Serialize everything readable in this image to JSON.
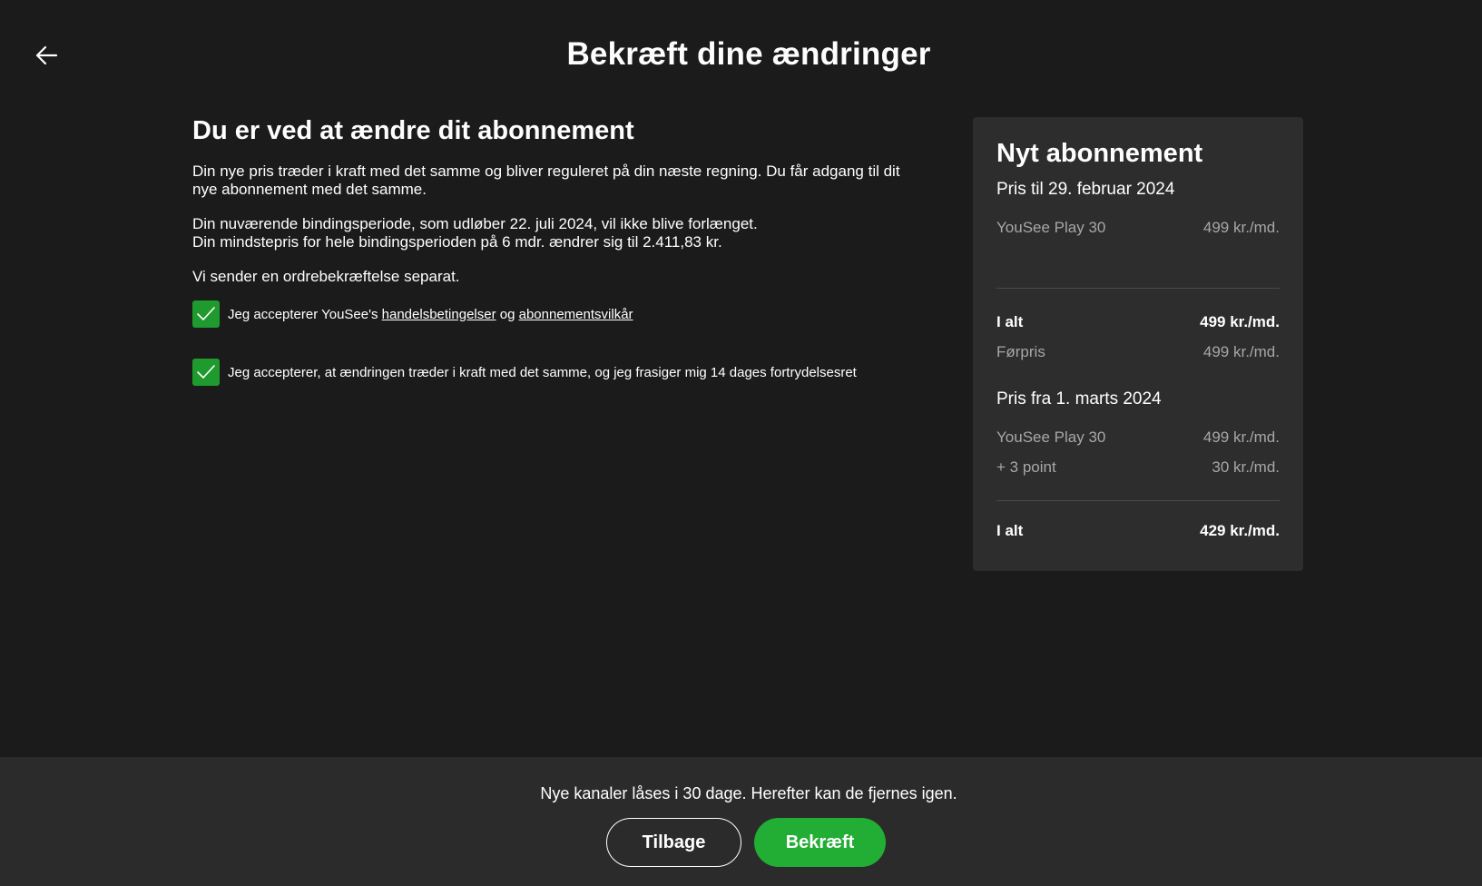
{
  "header": {
    "title": "Bekræft dine ændringer",
    "back_icon": "arrow-left-icon"
  },
  "info": {
    "heading": "Du er ved at ændre dit abonnement",
    "paragraph1": "Din nye pris træder i kraft med det samme og bliver reguleret på din næste regning. Du får adgang til dit nye abonnement med det samme.",
    "paragraph2_line1": "Din nuværende bindingsperiode, som udløber 22. juli 2024, vil ikke blive forlænget.",
    "paragraph2_line2": "Din mindstepris for hele bindingsperioden på 6 mdr. ændrer sig til 2.411,83 kr.",
    "paragraph3": "Vi sender en ordrebekræftelse separat."
  },
  "checkboxes": {
    "terms": {
      "checked": true,
      "prefix": "Jeg accepterer YouSee's",
      "link1": "handelsbetingelser",
      "middle": "og",
      "link2": "abonnementsvilkår"
    },
    "withdrawal": {
      "checked": true,
      "label": "Jeg accepterer, at ændringen træder i kraft med det samme, og jeg frasiger mig 14 dages fortrydelsesret"
    }
  },
  "summary": {
    "title": "Nyt abonnement",
    "period1": {
      "title": "Pris til 29. februar 2024",
      "items": [
        {
          "name": "YouSee Play 30",
          "price": "499 kr./md."
        }
      ],
      "total_label": "I alt",
      "total_value": "499 kr./md.",
      "prev_label": "Førpris",
      "prev_value": "499 kr./md."
    },
    "period2": {
      "title": "Pris fra 1. marts 2024",
      "items": [
        {
          "name": "YouSee Play 30",
          "price": "499 kr./md."
        },
        {
          "name": "+ 3 point",
          "price": "30 kr./md."
        }
      ],
      "total_label": "I alt",
      "total_value": "429 kr./md."
    }
  },
  "footer": {
    "note": "Nye kanaler låses i 30 dage. Herefter kan de fjernes igen.",
    "back_label": "Tilbage",
    "confirm_label": "Bekræft"
  },
  "colors": {
    "background": "#1b1b1b",
    "card": "#2d2d2d",
    "accent_green": "#22ad34"
  }
}
